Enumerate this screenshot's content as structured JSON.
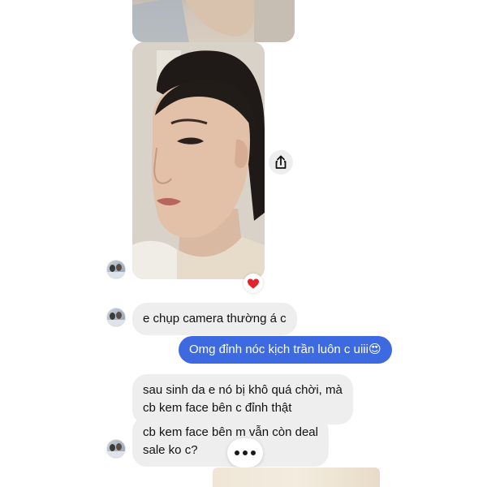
{
  "messages": [
    {
      "id": "m1",
      "text": "e chụp camera thường á c"
    },
    {
      "id": "m2",
      "text": "Omg đỉnh nóc kịch trần luôn c uiii😍"
    },
    {
      "id": "m3",
      "line1": "sau sinh da e nó bị khô quá chời, mà",
      "line2": "cb kem face bên c đỉnh thật"
    },
    {
      "id": "m4",
      "line1": "cb kem face bên m vẫn còn deal",
      "line2": "sale ko c?"
    }
  ],
  "reactions": {
    "heart": "❤️"
  },
  "colors": {
    "outgoing_bubble": "#3e6ae1",
    "incoming_bubble": "#eeeeee",
    "background": "#ffffff"
  },
  "icons": [
    "share-icon",
    "heart-reaction-icon",
    "typing-indicator-icon",
    "avatar"
  ]
}
